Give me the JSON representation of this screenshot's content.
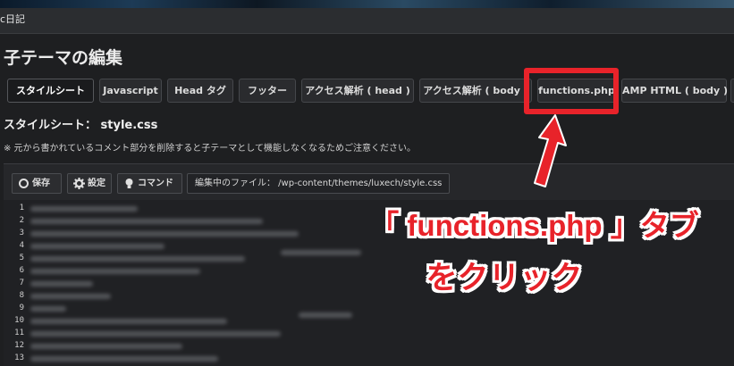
{
  "header": {
    "site_title": "c日記"
  },
  "page": {
    "title": "子テーマの編集"
  },
  "tabs": [
    {
      "label": "スタイルシート",
      "active": true
    },
    {
      "label": "Javascript"
    },
    {
      "label": "Head タグ"
    },
    {
      "label": "フッター"
    },
    {
      "label": "アクセス解析 ( head )"
    },
    {
      "label": "アクセス解析 ( body )"
    },
    {
      "label": "functions.php"
    },
    {
      "label": "AMP HTML ( body )"
    }
  ],
  "section": {
    "title": "スタイルシート： style.css",
    "notice": "※ 元から書かれているコメント部分を削除すると子テーマとして機能しなくなるためご注意ください。"
  },
  "toolbar": {
    "save_label": "保存",
    "settings_label": "設定",
    "command_label": "コマンド",
    "file_label": "編集中のファイル： /wp-content/themes/luxech/style.css"
  },
  "editor": {
    "line_numbers": [
      "1",
      "2",
      "3",
      "4",
      "5",
      "6",
      "7",
      "8",
      "9",
      "10",
      "11",
      "12",
      "13"
    ]
  },
  "annotation": {
    "line1": "「 functions.php 」タブ",
    "line2": "をクリック",
    "color": "#e8232a"
  }
}
